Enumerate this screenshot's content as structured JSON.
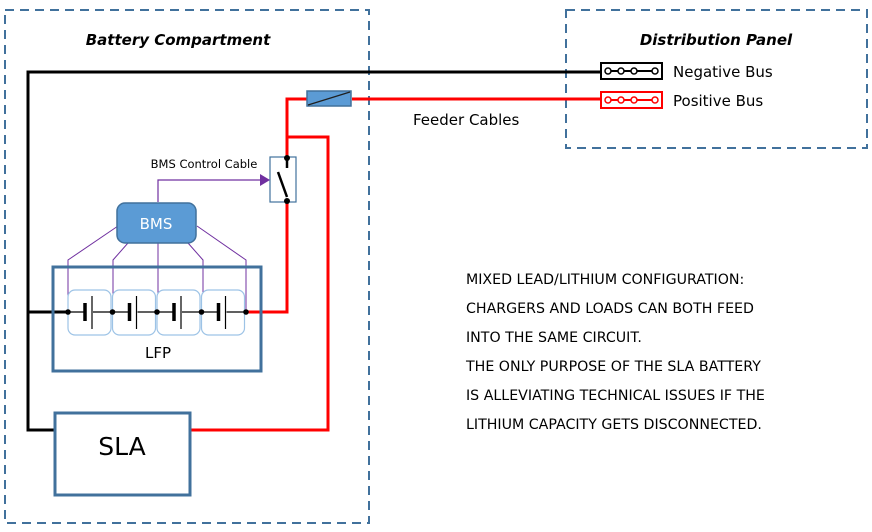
{
  "compartment": {
    "title": "Battery Compartment"
  },
  "panel": {
    "title": "Distribution Panel",
    "negative_bus": "Negative Bus",
    "positive_bus": "Positive Bus"
  },
  "feeder_label": "Feeder Cables",
  "bms": {
    "label": "BMS",
    "control_cable_label": "BMS Control Cable"
  },
  "lfp": {
    "label": "LFP",
    "cell_count": 4
  },
  "sla": {
    "label": "SLA"
  },
  "notes": [
    [
      "MIXED LEAD/LITHIUM CONFIGURATION:",
      "CHARGERS AND LOADS CAN BOTH FEED",
      "INTO THE SAME CIRCUIT."
    ],
    [
      "THE ONLY PURPOSE OF THE SLA BATTERY",
      "IS ALLEVIATING TECHNICAL ISSUES IF THE",
      "LITHIUM CAPACITY GETS DISCONNECTED."
    ]
  ],
  "colors": {
    "container_border": "#41719c",
    "positive_wire": "#ff0000",
    "negative_wire": "#000000",
    "bms_fill": "#5b9bd5",
    "bms_wire": "#7030a0",
    "cell_border": "#9dc3e6"
  }
}
